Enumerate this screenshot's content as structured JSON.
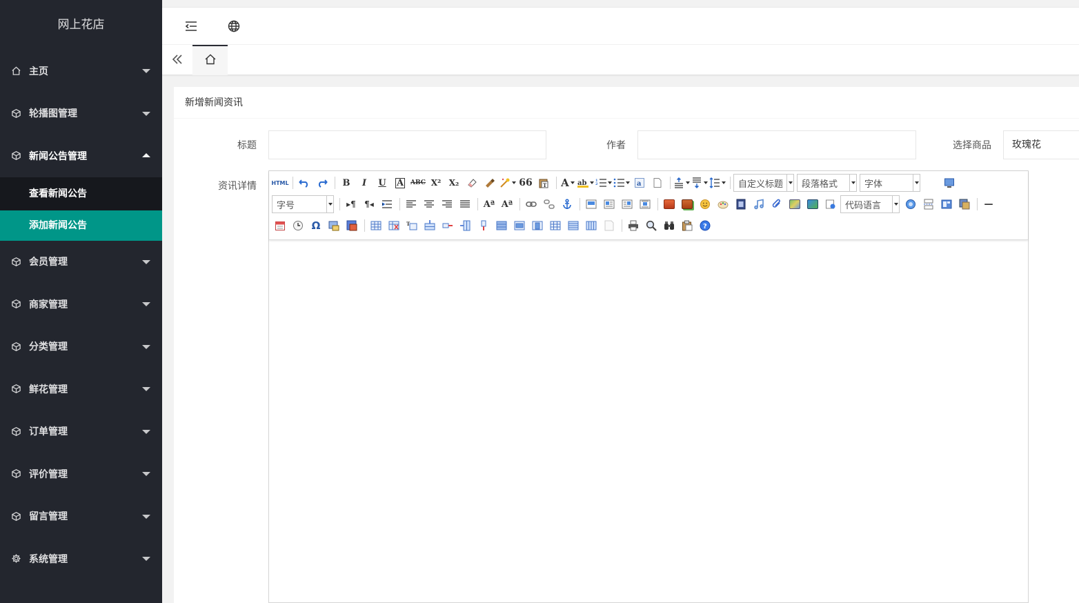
{
  "app": {
    "title": "网上花店"
  },
  "sidebar": {
    "items": [
      {
        "label": "主页",
        "icon": "home-icon"
      },
      {
        "label": "轮播图管理",
        "icon": "cube-icon"
      },
      {
        "label": "新闻公告管理",
        "icon": "cube-icon",
        "expanded": true,
        "children": [
          {
            "label": "查看新闻公告"
          },
          {
            "label": "添加新闻公告",
            "active": true
          }
        ]
      },
      {
        "label": "会员管理",
        "icon": "cube-icon"
      },
      {
        "label": "商家管理",
        "icon": "cube-icon"
      },
      {
        "label": "分类管理",
        "icon": "cube-icon"
      },
      {
        "label": "鲜花管理",
        "icon": "cube-icon"
      },
      {
        "label": "订单管理",
        "icon": "cube-icon"
      },
      {
        "label": "评价管理",
        "icon": "cube-icon"
      },
      {
        "label": "留言管理",
        "icon": "cube-icon"
      },
      {
        "label": "系统管理",
        "icon": "gear-icon"
      }
    ]
  },
  "topbar": {
    "icons": [
      "indent-icon",
      "globe-icon"
    ]
  },
  "tabs": {
    "back_icon": "double-chevron-left-icon",
    "home_icon": "home-icon"
  },
  "form": {
    "title": "新增新闻资讯",
    "fields": {
      "title_label": "标题",
      "title_value": "",
      "author_label": "作者",
      "author_value": "",
      "product_label": "选择商品",
      "product_value": "玫瑰花",
      "detail_label": "资讯详情"
    }
  },
  "editor": {
    "combos": {
      "custom_heading": "自定义标题",
      "paragraph": "段落格式",
      "font_family": "字体",
      "font_size": "字号",
      "code_language": "代码语言"
    },
    "buttons": {
      "html": "HTML",
      "bold": "B",
      "italic": "I",
      "underline": "U",
      "font_color": "A",
      "blockquote": "66",
      "horizontal_rule": "—",
      "special_char": "Ω"
    }
  },
  "colors": {
    "sidebar_bg": "#23262e",
    "active_bg": "#009688",
    "sub_bg": "#16181d"
  }
}
